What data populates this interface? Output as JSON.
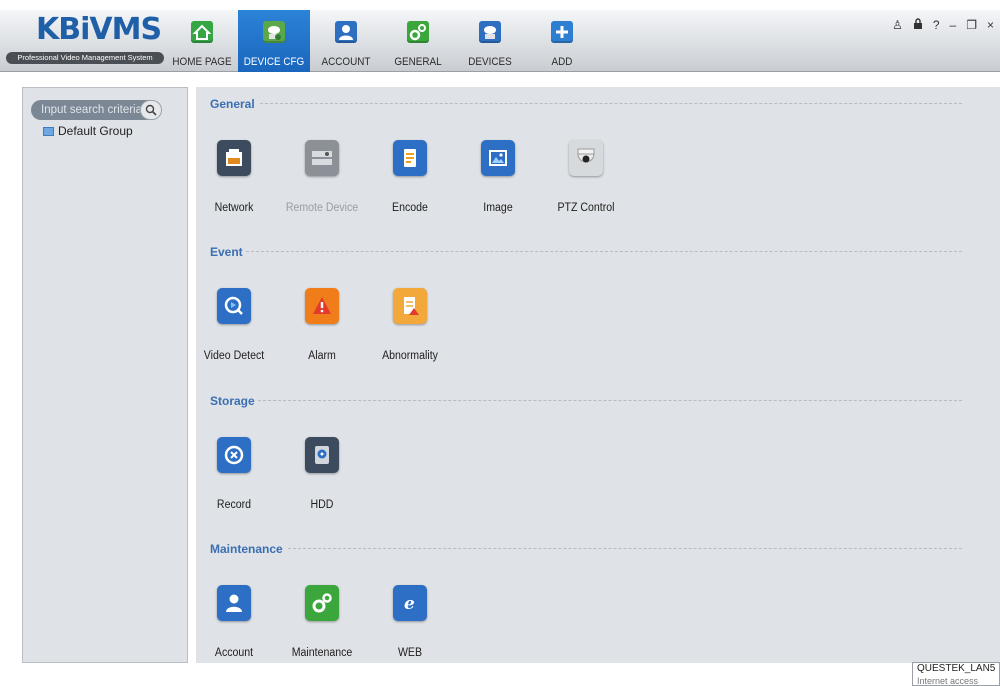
{
  "app": {
    "logo": "KBiVMS",
    "logo_sub": "Professional Video Management System"
  },
  "nav": [
    {
      "label": "HOME PAGE",
      "icon": "home-icon",
      "color": "#36a544",
      "active": false
    },
    {
      "label": "DEVICE CFG",
      "icon": "device-cfg-icon",
      "color": "#5aa84a",
      "active": true
    },
    {
      "label": "ACCOUNT",
      "icon": "account-icon",
      "color": "#2f6fc1",
      "active": false
    },
    {
      "label": "GENERAL",
      "icon": "general-icon",
      "color": "#3aa63c",
      "active": false
    },
    {
      "label": "DEVICES",
      "icon": "devices-icon",
      "color": "#2f6fc1",
      "active": false
    },
    {
      "label": "ADD",
      "icon": "add-icon",
      "color": "#2f7fd0",
      "active": false
    }
  ],
  "window_controls": {
    "user": "♙",
    "lock": "🔒",
    "help": "?",
    "minimize": "–",
    "restore": "❐",
    "close": "×"
  },
  "sidebar": {
    "search_placeholder": "Input search criteria",
    "tree": [
      {
        "label": "Default Group"
      }
    ]
  },
  "sections": [
    {
      "title": "General",
      "items": [
        {
          "label": "Network",
          "icon": "network-icon",
          "color": "#3c4c5e"
        },
        {
          "label": "Remote Device",
          "icon": "remote-device-icon",
          "color": "#8c9198",
          "disabled": true
        },
        {
          "label": "Encode",
          "icon": "encode-icon",
          "color": "#2d6fc4"
        },
        {
          "label": "Image",
          "icon": "image-icon",
          "color": "#2d6fc4"
        },
        {
          "label": "PTZ Control",
          "icon": "ptz-camera-icon",
          "color": "#d7dadd"
        }
      ]
    },
    {
      "title": "Event",
      "items": [
        {
          "label": "Video Detect",
          "icon": "video-detect-icon",
          "color": "#2d6fc4"
        },
        {
          "label": "Alarm",
          "icon": "alarm-icon",
          "color": "#f07d1a"
        },
        {
          "label": "Abnormality",
          "icon": "abnormality-icon",
          "color": "#f2a83a"
        }
      ]
    },
    {
      "title": "Storage",
      "items": [
        {
          "label": "Record",
          "icon": "record-icon",
          "color": "#2d6fc4"
        },
        {
          "label": "HDD",
          "icon": "hdd-icon",
          "color": "#3c4c5e"
        }
      ]
    },
    {
      "title": "Maintenance",
      "items": [
        {
          "label": "Account",
          "icon": "account-icon",
          "color": "#2d6fc4"
        },
        {
          "label": "Maintenance",
          "icon": "maintenance-icon",
          "color": "#3aa63c"
        },
        {
          "label": "WEB",
          "icon": "web-icon",
          "color": "#2d6fc4"
        }
      ]
    }
  ],
  "tray": {
    "text": "QUESTEK_LAN5",
    "sub": "Internet access"
  }
}
